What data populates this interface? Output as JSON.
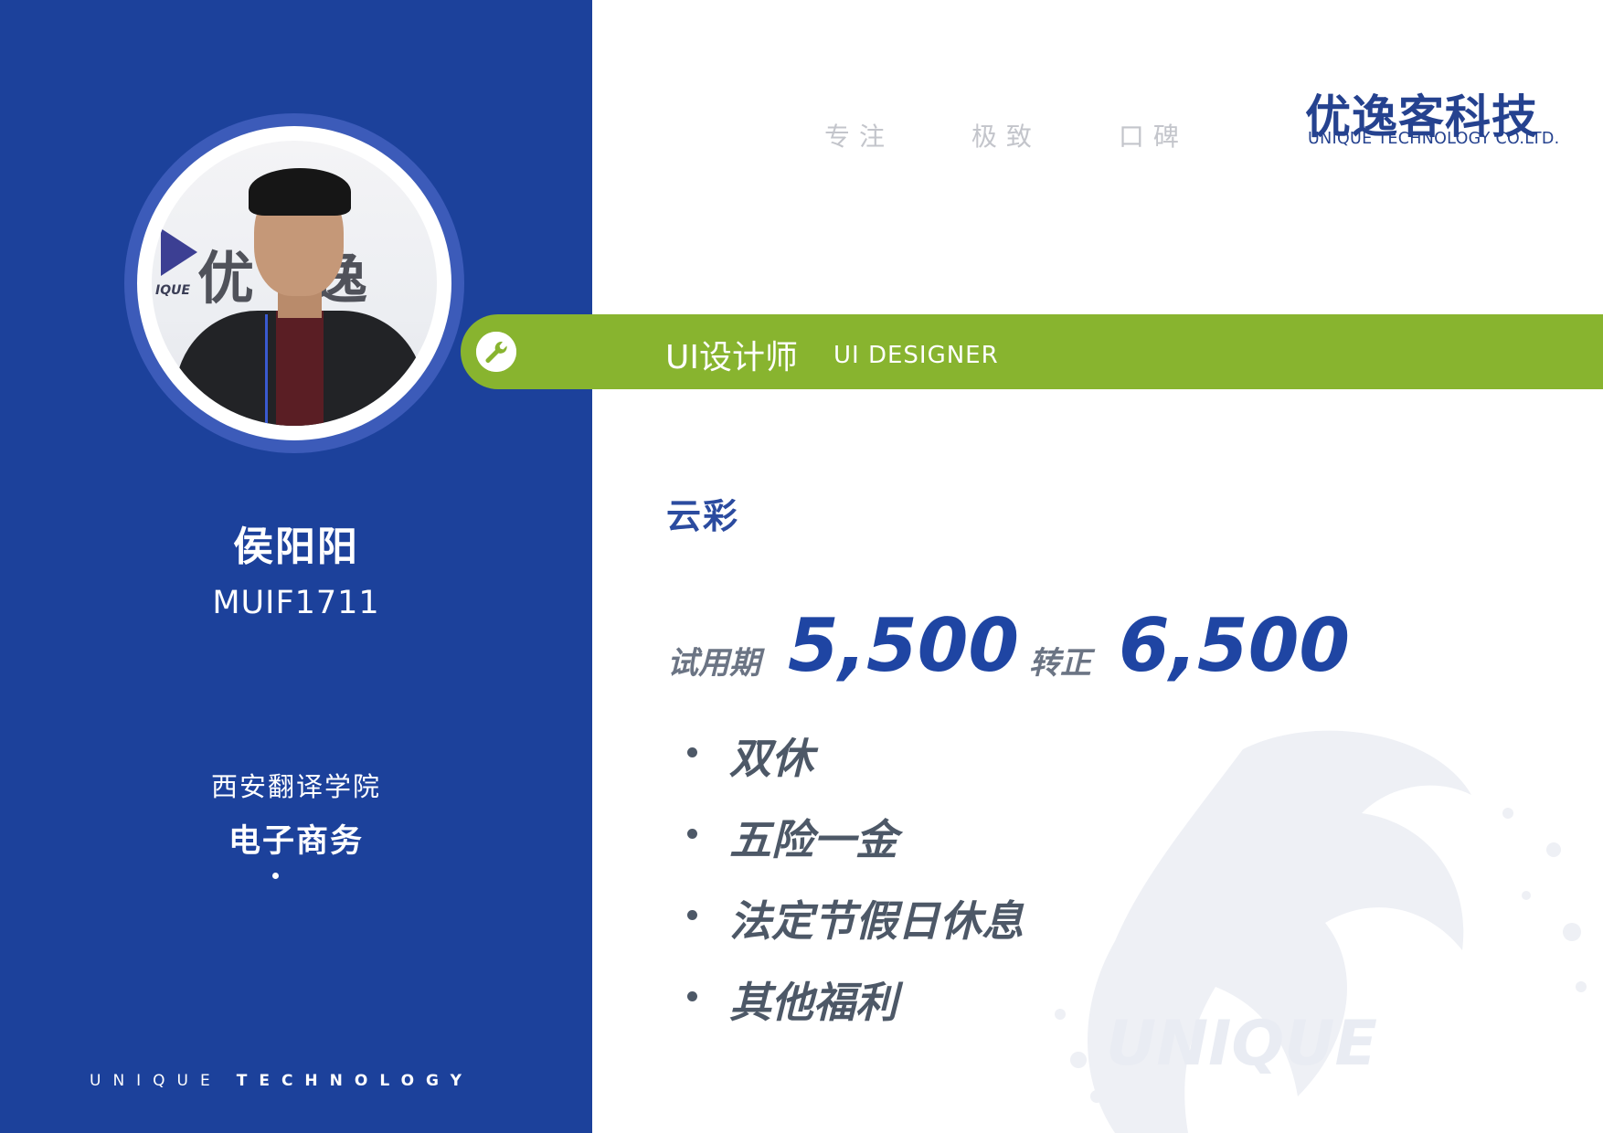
{
  "profile": {
    "name": "侯阳阳",
    "student_id": "MUIF1711",
    "school": "西安翻译学院",
    "major": "电子商务"
  },
  "footer": {
    "text_light": "UNIQUE",
    "text_bold": "TECHNOLOGY"
  },
  "header": {
    "slogans": [
      "专注",
      "极致",
      "口碑"
    ],
    "brand_cn": "优逸客科技",
    "brand_en": "UNIQUE TECHNOLOGY CO.LTD."
  },
  "job": {
    "title_cn": "UI设计师",
    "title_en": "UI DESIGNER",
    "icon": "wrench-icon"
  },
  "offer": {
    "company": "云彩",
    "probation_label": "试用期",
    "probation_salary": "5,500",
    "regular_label": "转正",
    "regular_salary": "6,500"
  },
  "benefits": [
    "双休",
    "五险一金",
    "法定节假日休息",
    "其他福利"
  ],
  "photo_wall": {
    "logo_text": "优逸客",
    "unique_text": "IQUE"
  },
  "watermark_text": "UNIQUE",
  "colors": {
    "primary_blue": "#1c419b",
    "accent_green": "#88b42f",
    "salary_blue": "#1f45a3",
    "text_gray": "#4d5867"
  }
}
